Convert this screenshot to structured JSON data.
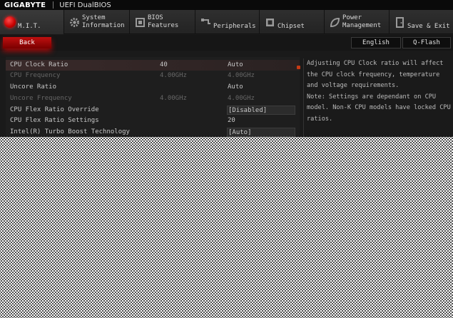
{
  "header": {
    "brand": "GIGABYTE",
    "bios_title": "UEFI DualBIOS"
  },
  "tabs": [
    {
      "id": "mit",
      "label": "M.I.T.",
      "icon": "mit-red-dot-icon",
      "active": true
    },
    {
      "id": "system",
      "label": "System\nInformation",
      "icon": "gear-icon"
    },
    {
      "id": "bios",
      "label": "BIOS\nFeatures",
      "icon": "bios-chip-icon"
    },
    {
      "id": "peripherals",
      "label": "Peripherals",
      "icon": "peripherals-icon"
    },
    {
      "id": "chipset",
      "label": "Chipset",
      "icon": "chipset-icon"
    },
    {
      "id": "power",
      "label": "Power\nManagement",
      "icon": "power-leaf-icon"
    },
    {
      "id": "save",
      "label": "Save & Exit",
      "icon": "exit-door-icon"
    }
  ],
  "subbar": {
    "back_label": "Back",
    "language_label": "English",
    "qflash_label": "Q-Flash"
  },
  "settings": {
    "rows": [
      {
        "name": "CPU Clock Ratio",
        "value": "40",
        "option": "Auto",
        "selected": true,
        "dim": false
      },
      {
        "name": "CPU Frequency",
        "value": "4.00GHz",
        "option": "4.00GHz",
        "dim": true
      },
      {
        "name": "Uncore Ratio",
        "value": "",
        "option": "Auto",
        "dim": false
      },
      {
        "name": "Uncore Frequency",
        "value": "4.00GHz",
        "option": "4.00GHz",
        "dim": true
      },
      {
        "name": "CPU Flex Ratio Override",
        "value": "",
        "option": "[Disabled]",
        "boxed": true,
        "dim": false
      },
      {
        "name": "CPU Flex Ratio Settings",
        "value": "",
        "option": "20",
        "dim": false
      },
      {
        "name": "Intel(R) Turbo Boost Technology",
        "value": "",
        "option": "[Auto]",
        "boxed": true,
        "dim": false
      }
    ]
  },
  "help": {
    "text": "Adjusting CPU Clock ratio will affect the CPU clock frequency, temperature and voltage requirements.",
    "note": "Note: Settings are dependant  on  CPU model. Non-K CPU models have locked CPU ratios."
  },
  "colors": {
    "accent_red": "#c01010",
    "background": "#1a1a1a"
  }
}
